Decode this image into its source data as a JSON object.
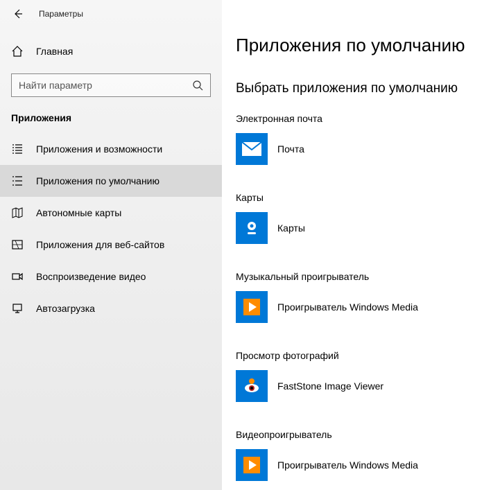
{
  "titlebar": {
    "label": "Параметры"
  },
  "home": {
    "label": "Главная"
  },
  "search": {
    "placeholder": "Найти параметр"
  },
  "section_header": "Приложения",
  "nav": [
    {
      "label": "Приложения и возможности"
    },
    {
      "label": "Приложения по умолчанию"
    },
    {
      "label": "Автономные карты"
    },
    {
      "label": "Приложения для веб-сайтов"
    },
    {
      "label": "Воспроизведение видео"
    },
    {
      "label": "Автозагрузка"
    }
  ],
  "main": {
    "title": "Приложения по умолчанию",
    "subtitle": "Выбрать приложения по умолчанию",
    "categories": [
      {
        "label": "Электронная почта",
        "app": "Почта"
      },
      {
        "label": "Карты",
        "app": "Карты"
      },
      {
        "label": "Музыкальный проигрыватель",
        "app": "Проигрыватель Windows Media"
      },
      {
        "label": "Просмотр фотографий",
        "app": "FastStone Image Viewer"
      },
      {
        "label": "Видеопроигрыватель",
        "app": "Проигрыватель Windows Media"
      }
    ]
  },
  "colors": {
    "accent": "#0078d7"
  }
}
